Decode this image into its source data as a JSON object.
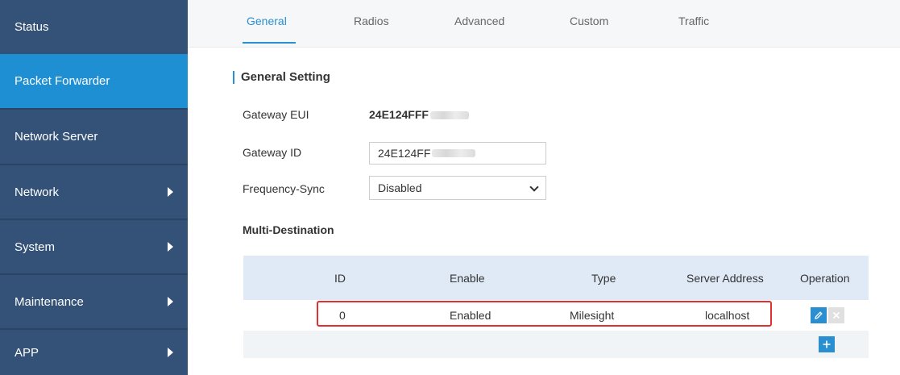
{
  "sidebar": {
    "items": [
      {
        "label": "Status",
        "has_submenu": false,
        "active": false
      },
      {
        "label": "Packet Forwarder",
        "has_submenu": false,
        "active": true
      },
      {
        "label": "Network Server",
        "has_submenu": false,
        "active": false
      },
      {
        "label": "Network",
        "has_submenu": true,
        "active": false
      },
      {
        "label": "System",
        "has_submenu": true,
        "active": false
      },
      {
        "label": "Maintenance",
        "has_submenu": true,
        "active": false
      },
      {
        "label": "APP",
        "has_submenu": true,
        "active": false
      }
    ]
  },
  "tabs": [
    {
      "label": "General",
      "active": true
    },
    {
      "label": "Radios",
      "active": false
    },
    {
      "label": "Advanced",
      "active": false
    },
    {
      "label": "Custom",
      "active": false
    },
    {
      "label": "Traffic",
      "active": false
    }
  ],
  "general": {
    "section_title": "General Setting",
    "gateway_eui_label": "Gateway EUI",
    "gateway_eui_value": "24E124FFF",
    "gateway_id_label": "Gateway ID",
    "gateway_id_value": "24E124FF",
    "frequency_sync_label": "Frequency-Sync",
    "frequency_sync_value": "Disabled"
  },
  "multi_destination": {
    "heading": "Multi-Destination",
    "columns": [
      "ID",
      "Enable",
      "Type",
      "Server Address",
      "Operation"
    ],
    "rows": [
      {
        "id": "0",
        "enable": "Enabled",
        "type": "Milesight",
        "server_address": "localhost"
      }
    ]
  },
  "colors": {
    "sidebar_bg": "#345277",
    "sidebar_active": "#1f8fd4",
    "accent": "#2a8fd0",
    "highlight_border": "#e03030"
  },
  "icons": {
    "edit": "pencil-icon",
    "delete": "close-icon",
    "add": "plus-icon",
    "submenu": "caret-right-icon",
    "select": "chevron-down-icon"
  }
}
